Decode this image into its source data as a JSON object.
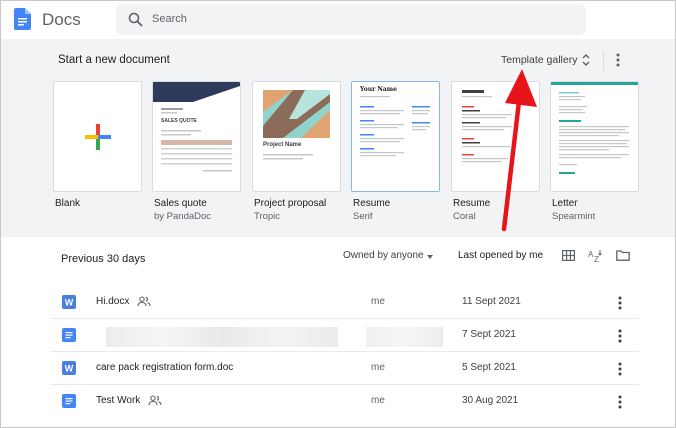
{
  "app": {
    "title": "Docs"
  },
  "search": {
    "placeholder": "Search"
  },
  "templates": {
    "section_title": "Start a new document",
    "gallery_label": "Template gallery",
    "items": [
      {
        "name": "Blank",
        "subtitle": ""
      },
      {
        "name": "Sales quote",
        "subtitle": "by PandaDoc"
      },
      {
        "name": "Project proposal",
        "subtitle": "Tropic"
      },
      {
        "name": "Resume",
        "subtitle": "Serif"
      },
      {
        "name": "Resume",
        "subtitle": "Coral"
      },
      {
        "name": "Letter",
        "subtitle": "Spearmint"
      }
    ],
    "thumb_text": {
      "sales_quote": "SALES QUOTE",
      "project_name": "Project Name",
      "your_name": "Your Name"
    }
  },
  "recent": {
    "title": "Previous 30 days",
    "owner_filter": "Owned by anyone",
    "sort_label": "Last opened by me",
    "rows": [
      {
        "name": "Hi.docx",
        "type": "word",
        "shared": true,
        "owner": "me",
        "date": "11 Sept 2021",
        "redacted": false
      },
      {
        "name": "",
        "type": "docs",
        "shared": false,
        "owner": "",
        "date": "7 Sept 2021",
        "redacted": true
      },
      {
        "name": "care pack registration form.doc",
        "type": "word",
        "shared": false,
        "owner": "me",
        "date": "5 Sept 2021",
        "redacted": false
      },
      {
        "name": "Test Work",
        "type": "docs",
        "shared": true,
        "owner": "me",
        "date": "30 Aug 2021",
        "redacted": false
      }
    ]
  },
  "colors": {
    "docs_blue": "#4285f4",
    "word_blue": "#4a7fdc",
    "annotation_red": "#e8141c",
    "template_band": "#f1f3f4"
  },
  "icons": [
    "docs-logo-icon",
    "search-icon",
    "updown-icon",
    "more-vert-icon",
    "plus-icon",
    "grid-view-icon",
    "sort-az-icon",
    "folder-icon",
    "people-icon",
    "doc-file-icon",
    "word-file-icon"
  ]
}
